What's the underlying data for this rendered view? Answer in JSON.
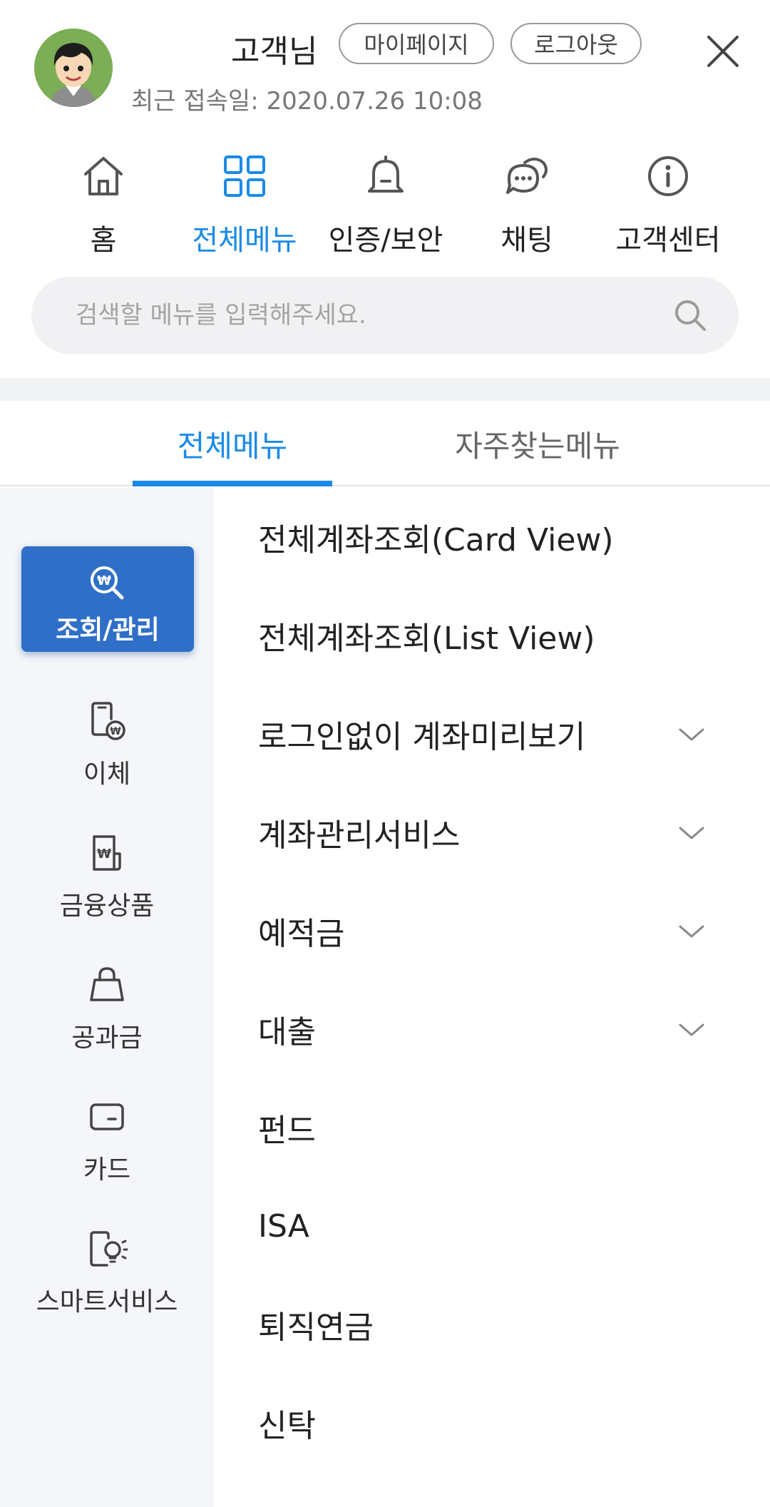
{
  "header": {
    "user_name": "고객님",
    "mypage_label": "마이페이지",
    "logout_label": "로그아웃",
    "last_login": "최근 접속일: 2020.07.26 10:08"
  },
  "quick_nav": [
    {
      "label": "홈",
      "icon": "home-icon",
      "active": false
    },
    {
      "label": "전체메뉴",
      "icon": "grid-icon",
      "active": true
    },
    {
      "label": "인증/보안",
      "icon": "bell-icon",
      "active": false
    },
    {
      "label": "채팅",
      "icon": "chat-icon",
      "active": false
    },
    {
      "label": "고객센터",
      "icon": "info-icon",
      "active": false
    }
  ],
  "search": {
    "placeholder": "검색할 메뉴를 입력해주세요."
  },
  "tabs": [
    {
      "label": "전체메뉴",
      "active": true
    },
    {
      "label": "자주찾는메뉴",
      "active": false
    }
  ],
  "sidebar": [
    {
      "label": "조회/관리",
      "icon": "search-won-icon",
      "active": true
    },
    {
      "label": "이체",
      "icon": "phone-won-icon",
      "active": false
    },
    {
      "label": "금융상품",
      "icon": "document-won-icon",
      "active": false
    },
    {
      "label": "공과금",
      "icon": "bag-icon",
      "active": false
    },
    {
      "label": "카드",
      "icon": "card-icon",
      "active": false
    },
    {
      "label": "스마트서비스",
      "icon": "phone-bulb-icon",
      "active": false
    }
  ],
  "menu": [
    {
      "label": "전체계좌조회(Card View)",
      "expandable": false
    },
    {
      "label": "전체계좌조회(List View)",
      "expandable": false
    },
    {
      "label": "로그인없이 계좌미리보기",
      "expandable": true
    },
    {
      "label": "계좌관리서비스",
      "expandable": true
    },
    {
      "label": "예적금",
      "expandable": true
    },
    {
      "label": "대출",
      "expandable": true
    },
    {
      "label": "펀드",
      "expandable": false
    },
    {
      "label": "ISA",
      "expandable": false
    },
    {
      "label": "퇴직연금",
      "expandable": false
    },
    {
      "label": "신탁",
      "expandable": false
    }
  ],
  "colors": {
    "accent": "#1a8ae6",
    "sidebar_active": "#2f6fc8",
    "sidebar_bg": "#f4f6f9",
    "search_bg": "#f1f1f3"
  }
}
